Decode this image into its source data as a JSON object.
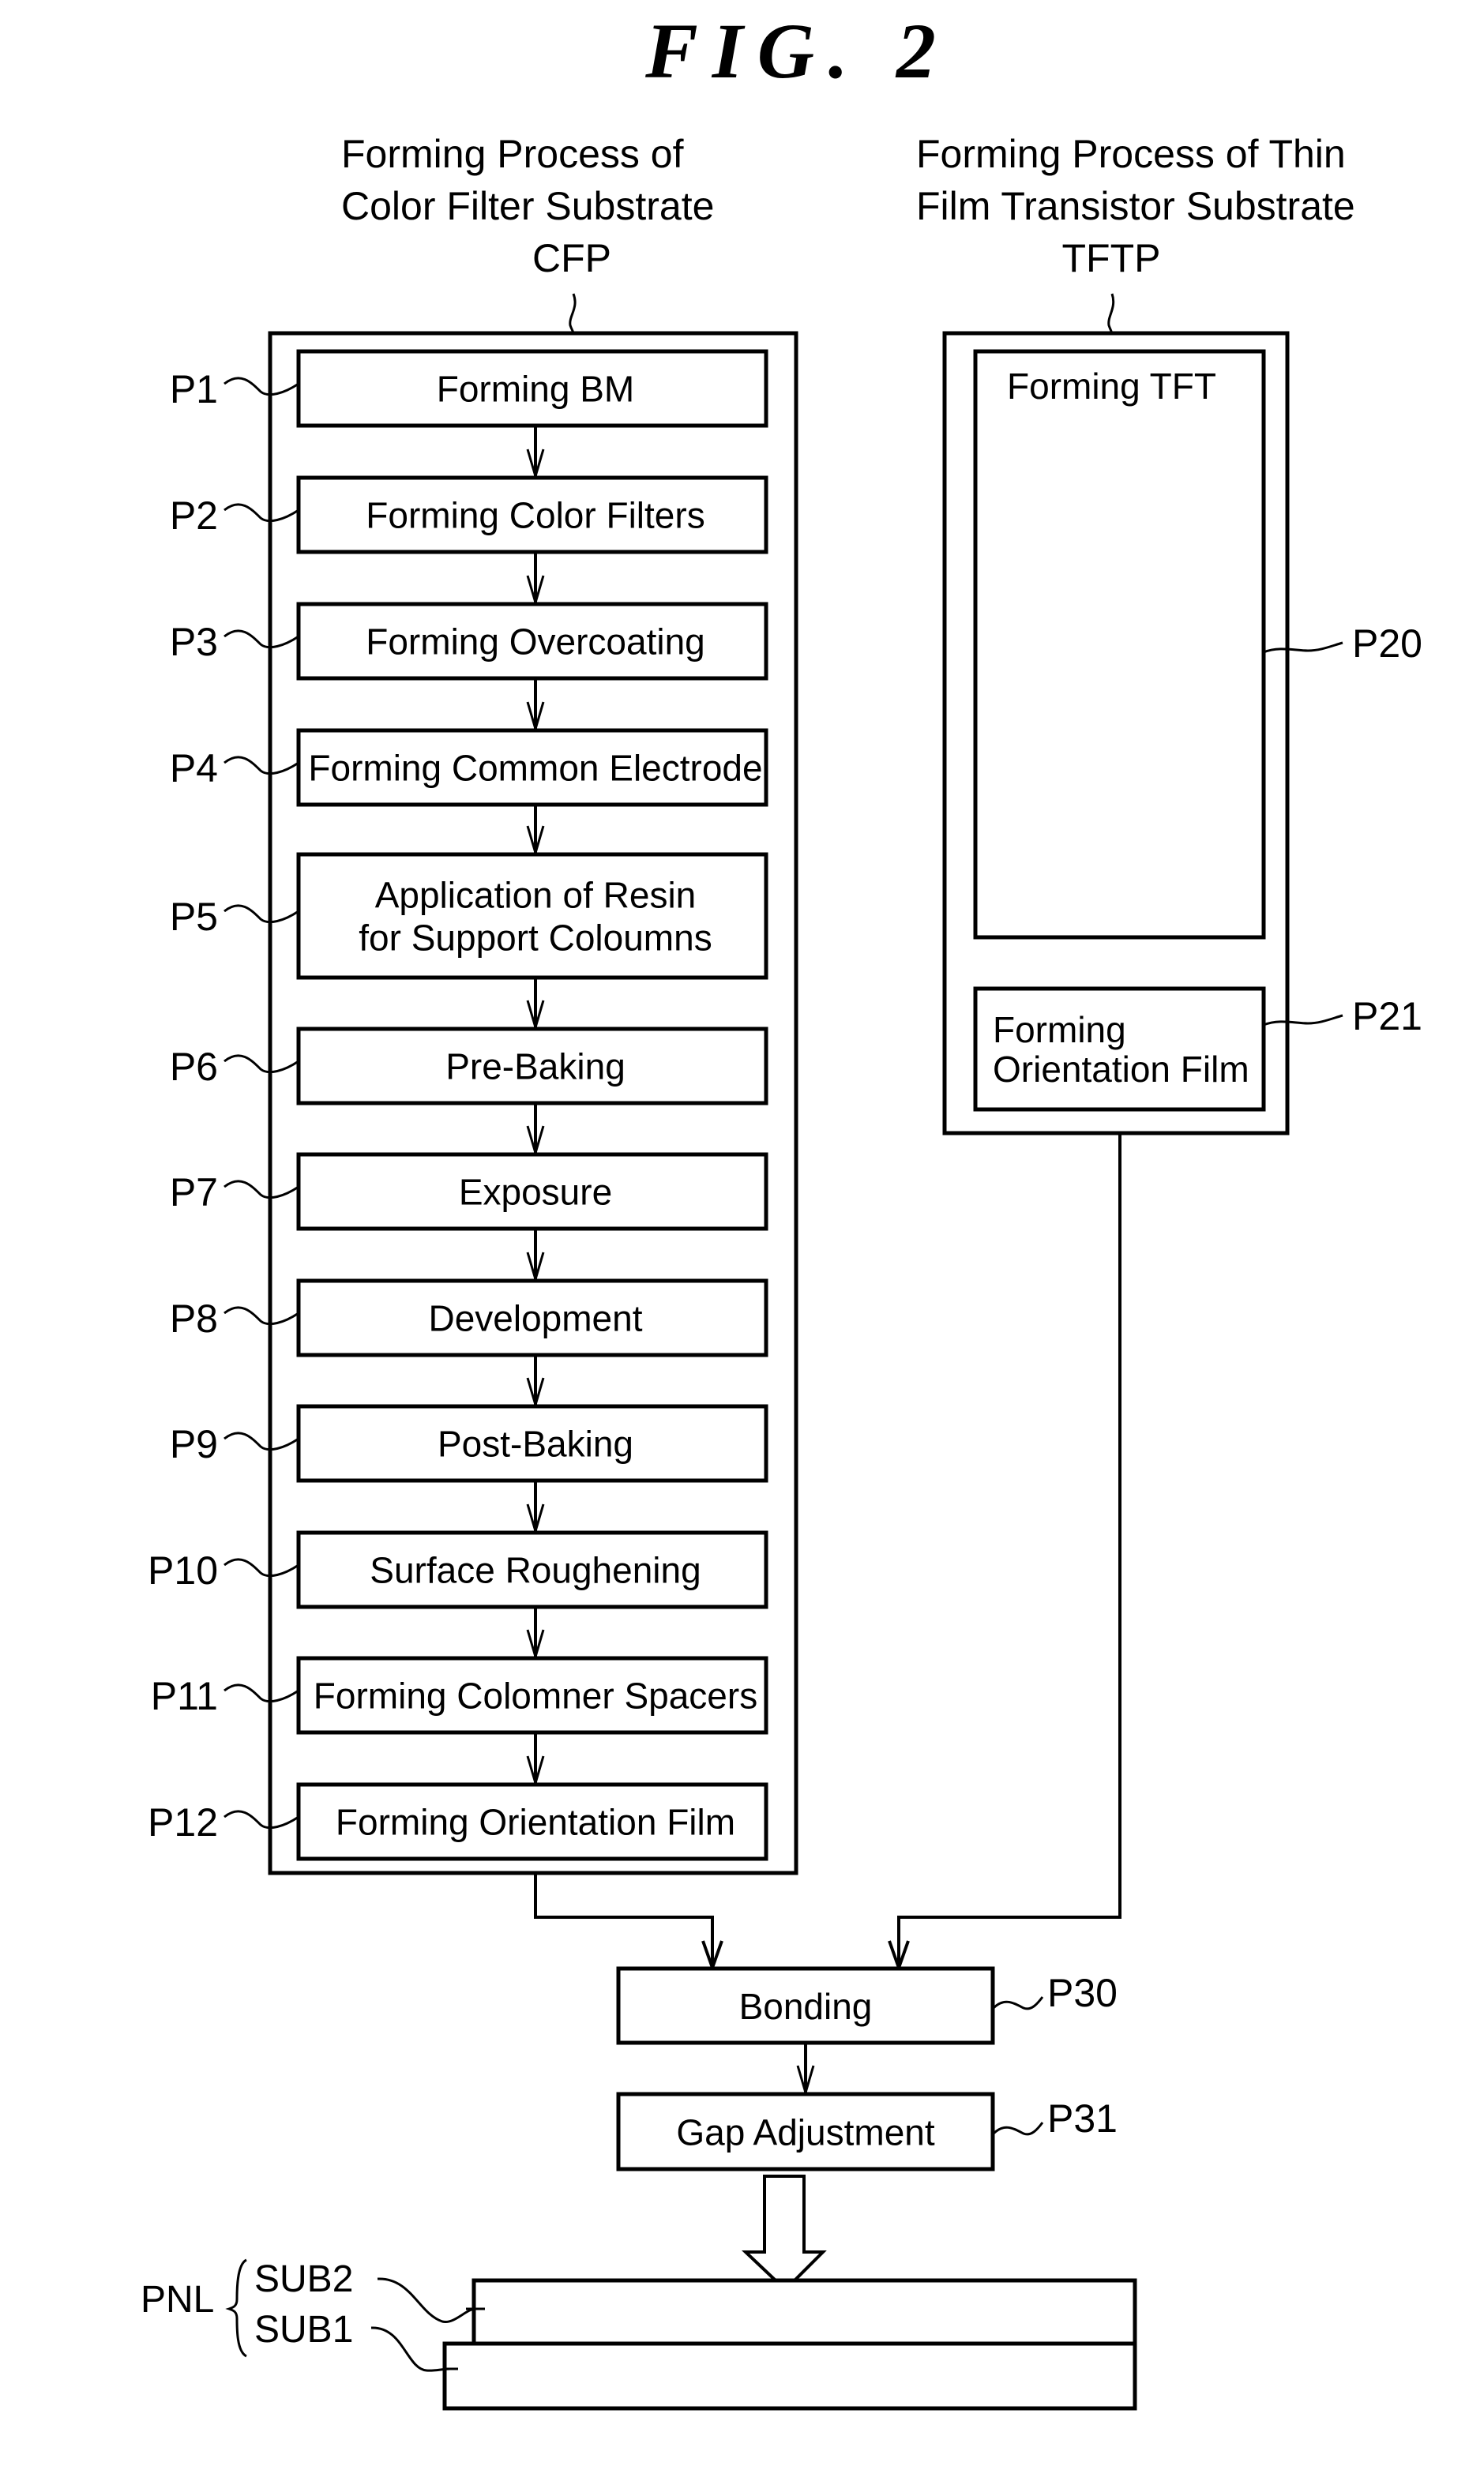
{
  "figure": {
    "title": "FIG. 2"
  },
  "cfp": {
    "heading_lines": [
      "Forming Process of",
      "Color Filter Substrate",
      "CFP"
    ],
    "steps": [
      {
        "ref": "P1",
        "lines": [
          "Forming BM"
        ]
      },
      {
        "ref": "P2",
        "lines": [
          "Forming Color Filters"
        ]
      },
      {
        "ref": "P3",
        "lines": [
          "Forming Overcoating"
        ]
      },
      {
        "ref": "P4",
        "lines": [
          "Forming Common Electrode"
        ]
      },
      {
        "ref": "P5",
        "lines": [
          "Application of Resin",
          "for Support Coloumns"
        ]
      },
      {
        "ref": "P6",
        "lines": [
          "Pre-Baking"
        ]
      },
      {
        "ref": "P7",
        "lines": [
          "Exposure"
        ]
      },
      {
        "ref": "P8",
        "lines": [
          "Development"
        ]
      },
      {
        "ref": "P9",
        "lines": [
          "Post-Baking"
        ]
      },
      {
        "ref": "P10",
        "lines": [
          "Surface Roughening"
        ]
      },
      {
        "ref": "P11",
        "lines": [
          "Forming Colomner Spacers"
        ]
      },
      {
        "ref": "P12",
        "lines": [
          "Forming Orientation Film"
        ]
      }
    ]
  },
  "tftp": {
    "heading_lines": [
      "Forming Process of Thin",
      "Film Transistor Substrate",
      "TFTP"
    ],
    "steps": [
      {
        "ref": "P20",
        "lines": [
          "Forming TFT"
        ]
      },
      {
        "ref": "P21",
        "lines": [
          "Forming",
          "Orientation Film"
        ]
      }
    ]
  },
  "final": {
    "steps": [
      {
        "ref": "P30",
        "lines": [
          "Bonding"
        ]
      },
      {
        "ref": "P31",
        "lines": [
          "Gap Adjustment"
        ]
      }
    ]
  },
  "panel": {
    "group_label": "PNL",
    "layers": [
      {
        "ref": "SUB2"
      },
      {
        "ref": "SUB1"
      }
    ]
  }
}
